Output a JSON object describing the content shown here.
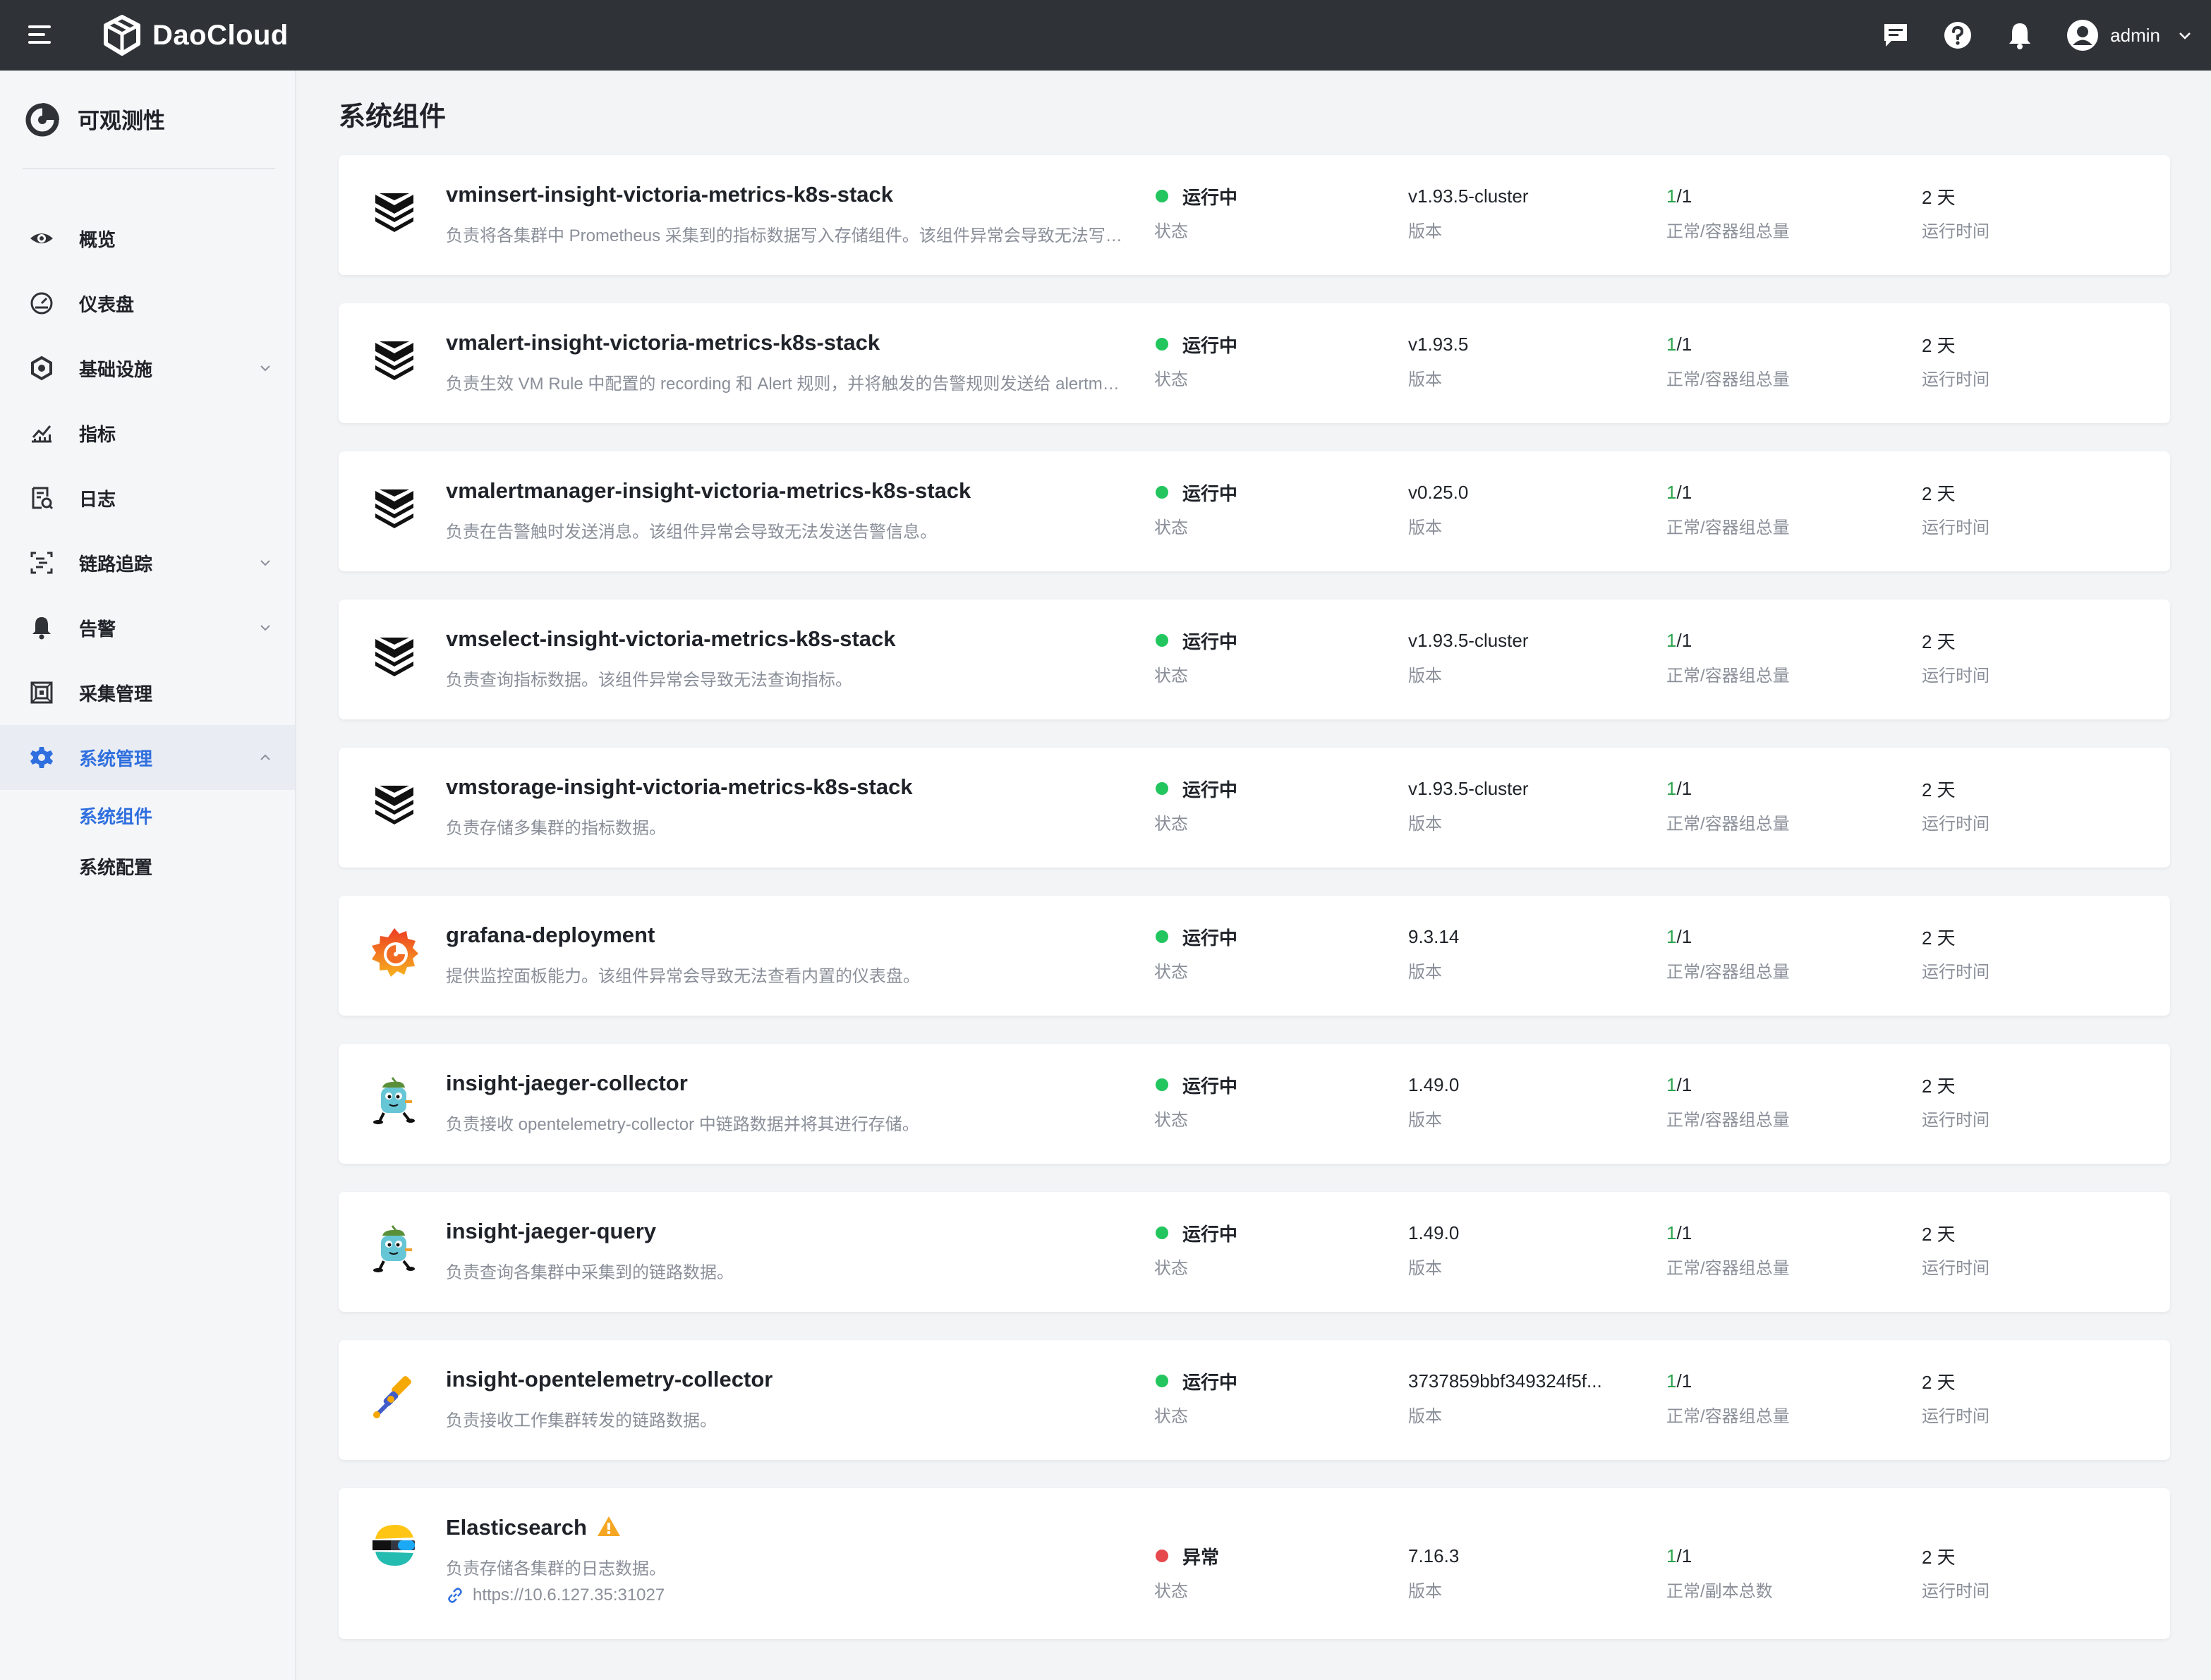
{
  "topbar": {
    "brand": "DaoCloud",
    "user_name": "admin"
  },
  "sidebar": {
    "title": "可观测性",
    "items": [
      {
        "label": "概览"
      },
      {
        "label": "仪表盘"
      },
      {
        "label": "基础设施"
      },
      {
        "label": "指标"
      },
      {
        "label": "日志"
      },
      {
        "label": "链路追踪"
      },
      {
        "label": "告警"
      },
      {
        "label": "采集管理"
      },
      {
        "label": "系统管理"
      }
    ],
    "sub_items": [
      {
        "label": "系统组件"
      },
      {
        "label": "系统配置"
      }
    ]
  },
  "page": {
    "title": "系统组件"
  },
  "labels": {
    "status": "状态",
    "version": "版本",
    "pods": "正常/容器组总量",
    "replicas": "正常/副本总数",
    "uptime": "运行时间"
  },
  "colors": {
    "running": "#22c55e",
    "abnormal": "#e5484d",
    "accent": "#2f6fde",
    "ok_count": "#2ea44f",
    "warning": "#f5a623"
  },
  "components": [
    {
      "icon": "victoria-metrics-icon",
      "name": "vminsert-insight-victoria-metrics-k8s-stack",
      "desc": "负责将各集群中 Prometheus 采集到的指标数据写入存储组件。该组件异常会导致无法写入指标数据。",
      "status": "运行中",
      "version": "v1.93.5-cluster",
      "ok": "1",
      "total": "/1",
      "uptime": "2 天"
    },
    {
      "icon": "victoria-metrics-icon",
      "name": "vmalert-insight-victoria-metrics-k8s-stack",
      "desc": "负责生效 VM Rule 中配置的 recording 和 Alert 规则，并将触发的告警规则发送给 alertmanager。",
      "status": "运行中",
      "version": "v1.93.5",
      "ok": "1",
      "total": "/1",
      "uptime": "2 天"
    },
    {
      "icon": "victoria-metrics-icon",
      "name": "vmalertmanager-insight-victoria-metrics-k8s-stack",
      "desc": "负责在告警触时发送消息。该组件异常会导致无法发送告警信息。",
      "status": "运行中",
      "version": "v0.25.0",
      "ok": "1",
      "total": "/1",
      "uptime": "2 天"
    },
    {
      "icon": "victoria-metrics-icon",
      "name": "vmselect-insight-victoria-metrics-k8s-stack",
      "desc": "负责查询指标数据。该组件异常会导致无法查询指标。",
      "status": "运行中",
      "version": "v1.93.5-cluster",
      "ok": "1",
      "total": "/1",
      "uptime": "2 天"
    },
    {
      "icon": "victoria-metrics-icon",
      "name": "vmstorage-insight-victoria-metrics-k8s-stack",
      "desc": "负责存储多集群的指标数据。",
      "status": "运行中",
      "version": "v1.93.5-cluster",
      "ok": "1",
      "total": "/1",
      "uptime": "2 天"
    },
    {
      "icon": "grafana-icon",
      "name": "grafana-deployment",
      "desc": "提供监控面板能力。该组件异常会导致无法查看内置的仪表盘。",
      "status": "运行中",
      "version": "9.3.14",
      "ok": "1",
      "total": "/1",
      "uptime": "2 天"
    },
    {
      "icon": "jaeger-icon",
      "name": "insight-jaeger-collector",
      "desc": "负责接收 opentelemetry-collector 中链路数据并将其进行存储。",
      "status": "运行中",
      "version": "1.49.0",
      "ok": "1",
      "total": "/1",
      "uptime": "2 天"
    },
    {
      "icon": "jaeger-icon",
      "name": "insight-jaeger-query",
      "desc": "负责查询各集群中采集到的链路数据。",
      "status": "运行中",
      "version": "1.49.0",
      "ok": "1",
      "total": "/1",
      "uptime": "2 天"
    },
    {
      "icon": "opentelemetry-icon",
      "name": "insight-opentelemetry-collector",
      "desc": "负责接收工作集群转发的链路数据。",
      "status": "运行中",
      "version": "3737859bbf349324f5f...",
      "ok": "1",
      "total": "/1",
      "uptime": "2 天"
    },
    {
      "icon": "elasticsearch-icon",
      "name": "Elasticsearch",
      "desc": "负责存储各集群的日志数据。",
      "link": "https://10.6.127.35:31027",
      "status": "异常",
      "version": "7.16.3",
      "ok": "1",
      "total": "/1",
      "uptime": "2 天"
    }
  ]
}
